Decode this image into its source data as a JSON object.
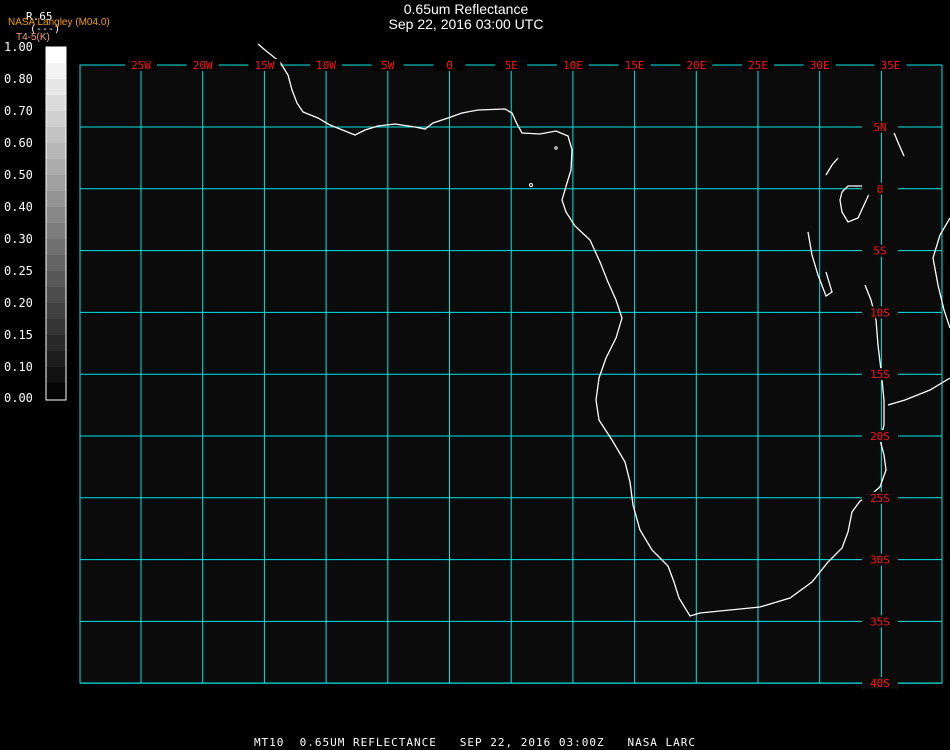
{
  "header": {
    "title": "0.65um Reflectance",
    "subtitle": "Sep 22, 2016 03:00 UTC",
    "agency": "NASA Langley (M04.0)"
  },
  "colorbar": {
    "title": "R.65",
    "unit": "(---)",
    "subtitle": "T4-5(K)",
    "range": [
      0,
      1
    ],
    "labels": [
      "1.00",
      "0.80",
      "0.70",
      "0.60",
      "0.50",
      "0.40",
      "0.30",
      "0.25",
      "0.20",
      "0.15",
      "0.10",
      "0.00"
    ]
  },
  "map": {
    "background": "#0b0b0b",
    "grid_color": "#00e5e5",
    "label_color": "#ff1010",
    "coast_color": "#ffffff",
    "lon_labels": [
      "25W",
      "20W",
      "15W",
      "10W",
      "5W",
      "0",
      "5E",
      "10E",
      "15E",
      "20E",
      "25E",
      "30E",
      "35E"
    ],
    "lat_labels": [
      "5N",
      "0",
      "5S",
      "10S",
      "15S",
      "20S",
      "25S",
      "30S",
      "35S",
      "40S"
    ]
  },
  "footer": {
    "text": "MT10  0.65UM REFLECTANCE   SEP 22, 2016 03:00Z   NASA LARC"
  }
}
